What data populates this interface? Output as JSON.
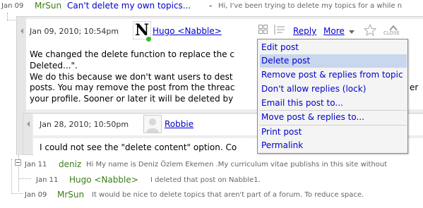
{
  "header": {
    "date": "Jan 09",
    "author": "MrSun",
    "subject": "Can't delete my own topics...",
    "dash": "-",
    "snippet": "Hi, I've been trying to delete my topics for a while n"
  },
  "post": {
    "date": "Jan 09, 2010; 10:54pm",
    "author": "Hugo <Nabble>",
    "avatar_letter": "N",
    "reply_label": "Reply",
    "more_label": "More",
    "close_label": "CLOSE",
    "body_lines": [
      "We changed the delete function to replace the c",
      "Deleted...\".",
      "We do this because we don't want users to dest",
      "posts. You may remove the post from the threac",
      "your profile. Sooner or later it will be deleted by"
    ],
    "body_tail": "er"
  },
  "reply": {
    "date": "Jan 28, 2010; 10:50pm",
    "author": "Robbie",
    "body": "I could not see the \"delete content\" option. Co"
  },
  "menu": {
    "items": [
      {
        "label": "Edit post"
      },
      {
        "label": "Delete post"
      },
      {
        "label": "Remove post & replies from topic"
      },
      {
        "label": "Don't allow replies (lock)"
      },
      {
        "label": "Email this post to..."
      },
      {
        "label": "Move post & replies to..."
      },
      {
        "label": "Print post"
      },
      {
        "label": "Permalink"
      }
    ],
    "highlighted": "Delete post"
  },
  "thread": [
    {
      "date": "Jan 11",
      "author": "deniz",
      "snippet": "Hi My name is Deniz Özlem Ekemen .My curriculum vitae publishs in this site without"
    },
    {
      "date": "Jan 11",
      "author": "Hugo <Nabble>",
      "snippet": "I deleted that post on Nabble1."
    },
    {
      "date": "Jan 09",
      "author": "MrSun",
      "snippet": "It would be nice to delete topics that aren't part of a forum. To reduce space."
    }
  ],
  "colors": {
    "link": "#0000cc",
    "author": "#3b7d14",
    "menu_highlight": "#c8d6ee",
    "online": "#33bb33"
  }
}
